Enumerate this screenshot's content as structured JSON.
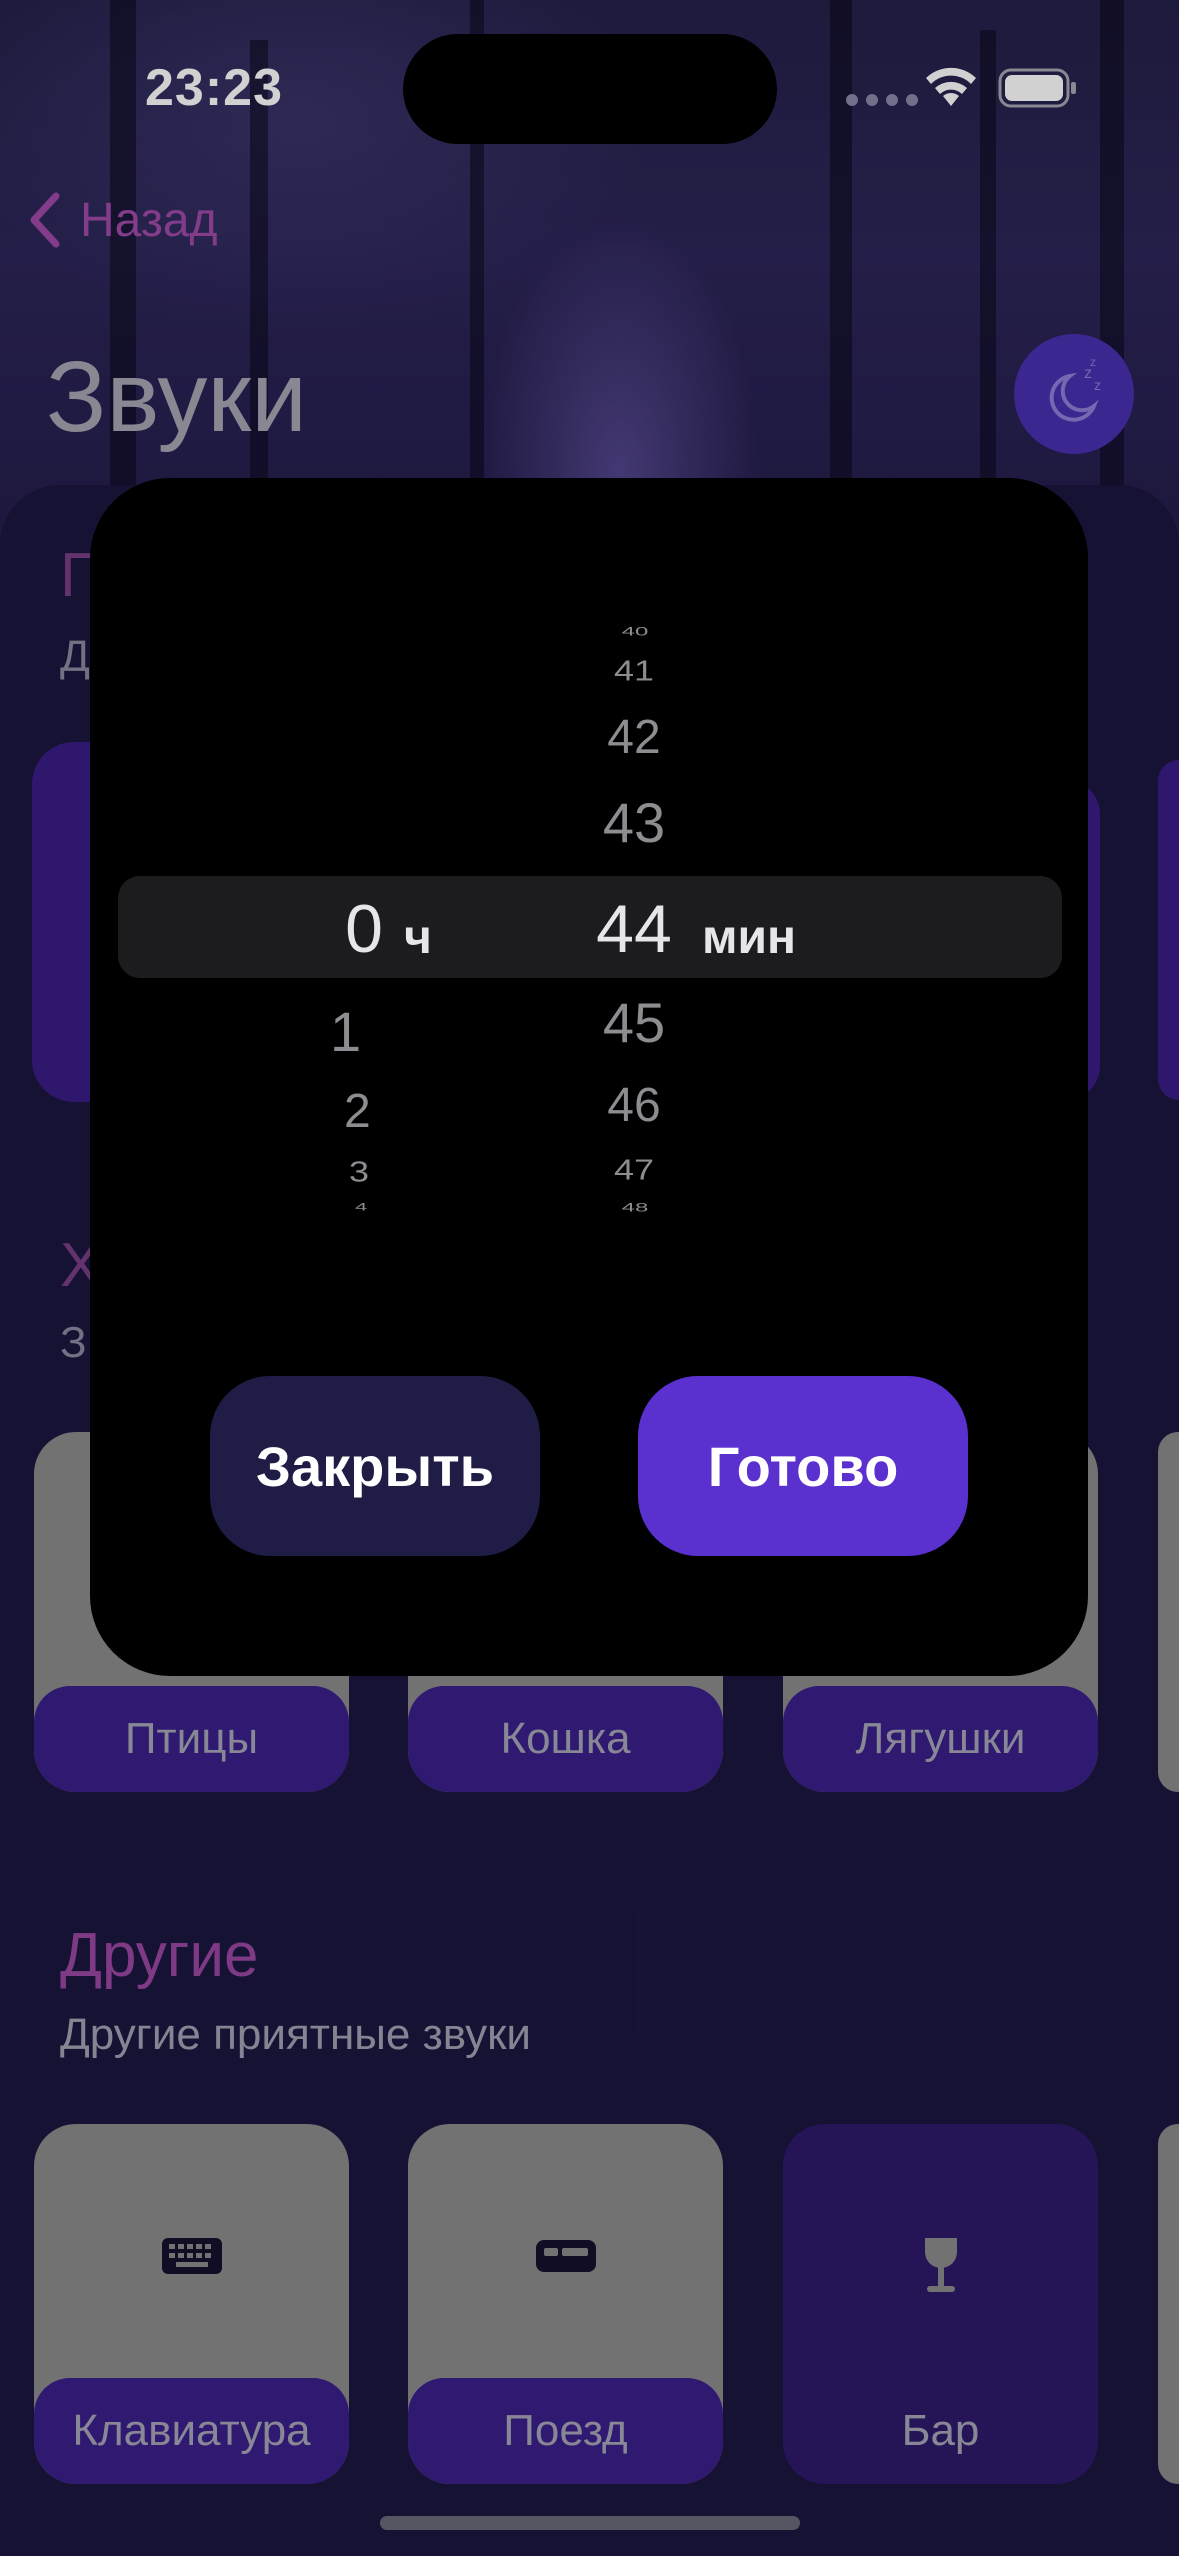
{
  "status_bar": {
    "time": "23:23"
  },
  "header": {
    "back_label": "Назад",
    "title": "Звуки"
  },
  "sections": {
    "first": {
      "title_peek": "П",
      "subtitle_peek": "Д"
    },
    "second": {
      "title_peek": "Х",
      "subtitle_peek": "З"
    },
    "animals": {
      "cards": [
        "Птицы",
        "Кошка",
        "Лягушки"
      ]
    },
    "other": {
      "title": "Другие",
      "subtitle": "Другие приятные звуки",
      "cards": [
        "Клавиатура",
        "Поезд",
        "Бар"
      ]
    }
  },
  "picker": {
    "hours_above": [],
    "hours_selected": "0",
    "hours_unit": "ч",
    "hours_below": [
      "1",
      "2",
      "3",
      "4"
    ],
    "minutes_above": [
      "40",
      "41",
      "42",
      "43"
    ],
    "minutes_selected": "44",
    "minutes_unit": "мин",
    "minutes_below": [
      "45",
      "46",
      "47",
      "48"
    ]
  },
  "modal": {
    "close_label": "Закрыть",
    "done_label": "Готово"
  },
  "colors": {
    "accent": "#5a30cf",
    "title_purple": "#9c47a4",
    "card_bar": "#3a1f8a"
  },
  "icons": [
    "chevron-left-icon",
    "moon-sleep-icon",
    "wifi-icon",
    "battery-icon",
    "keyboard-icon",
    "train-icon",
    "wine-glass-icon"
  ]
}
